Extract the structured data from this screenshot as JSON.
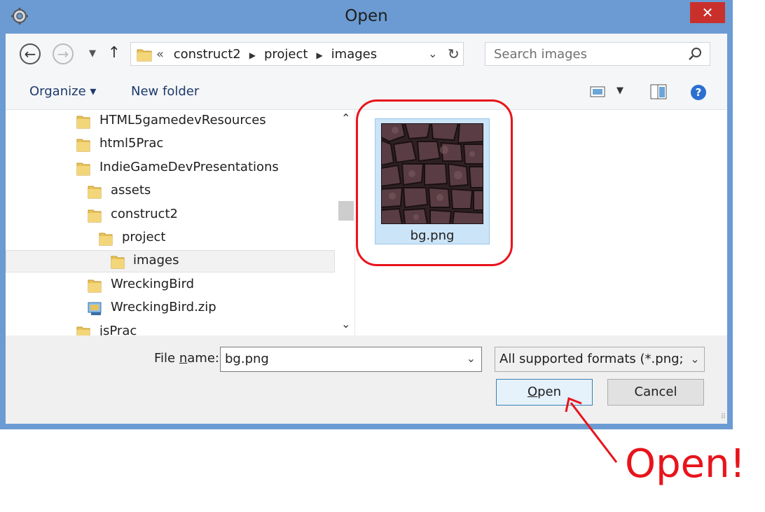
{
  "window": {
    "title": "Open",
    "close_glyph": "✕"
  },
  "address": {
    "breadcrumb_prefix": "«",
    "crumbs": [
      "construct2",
      "project",
      "images"
    ],
    "search_placeholder": "Search images"
  },
  "toolbar": {
    "organize_label": "Organize ▾",
    "new_folder_label": "New folder",
    "help_glyph": "?"
  },
  "tree": {
    "items": [
      {
        "label": "HTML5gamedevResources",
        "level": 0,
        "type": "folder"
      },
      {
        "label": "html5Prac",
        "level": 0,
        "type": "folder"
      },
      {
        "label": "IndieGameDevPresentations",
        "level": 0,
        "type": "folder"
      },
      {
        "label": "assets",
        "level": 1,
        "type": "folder"
      },
      {
        "label": "construct2",
        "level": 1,
        "type": "folder"
      },
      {
        "label": "project",
        "level": 2,
        "type": "folder"
      },
      {
        "label": "images",
        "level": 3,
        "type": "folder",
        "selected": true
      },
      {
        "label": "WreckingBird",
        "level": 1,
        "type": "folder"
      },
      {
        "label": "WreckingBird.zip",
        "level": 1,
        "type": "zip"
      },
      {
        "label": "jsPrac",
        "level": 0,
        "type": "folder"
      }
    ]
  },
  "files": [
    {
      "name": "bg.png",
      "selected": true
    }
  ],
  "bottom": {
    "file_name_label_pre": "File ",
    "file_name_label_underline": "n",
    "file_name_label_post": "ame:",
    "file_name_value": "bg.png",
    "type_filter": "All supported formats (*.png; *.",
    "open_label_underline": "O",
    "open_label_rest": "pen",
    "cancel_label": "Cancel"
  },
  "annotation": {
    "text": "Open!",
    "color": "#e8141b"
  },
  "colors": {
    "titlebar": "#6b9bd2",
    "accent_red": "#e8141b",
    "selection": "#cce4f7"
  }
}
